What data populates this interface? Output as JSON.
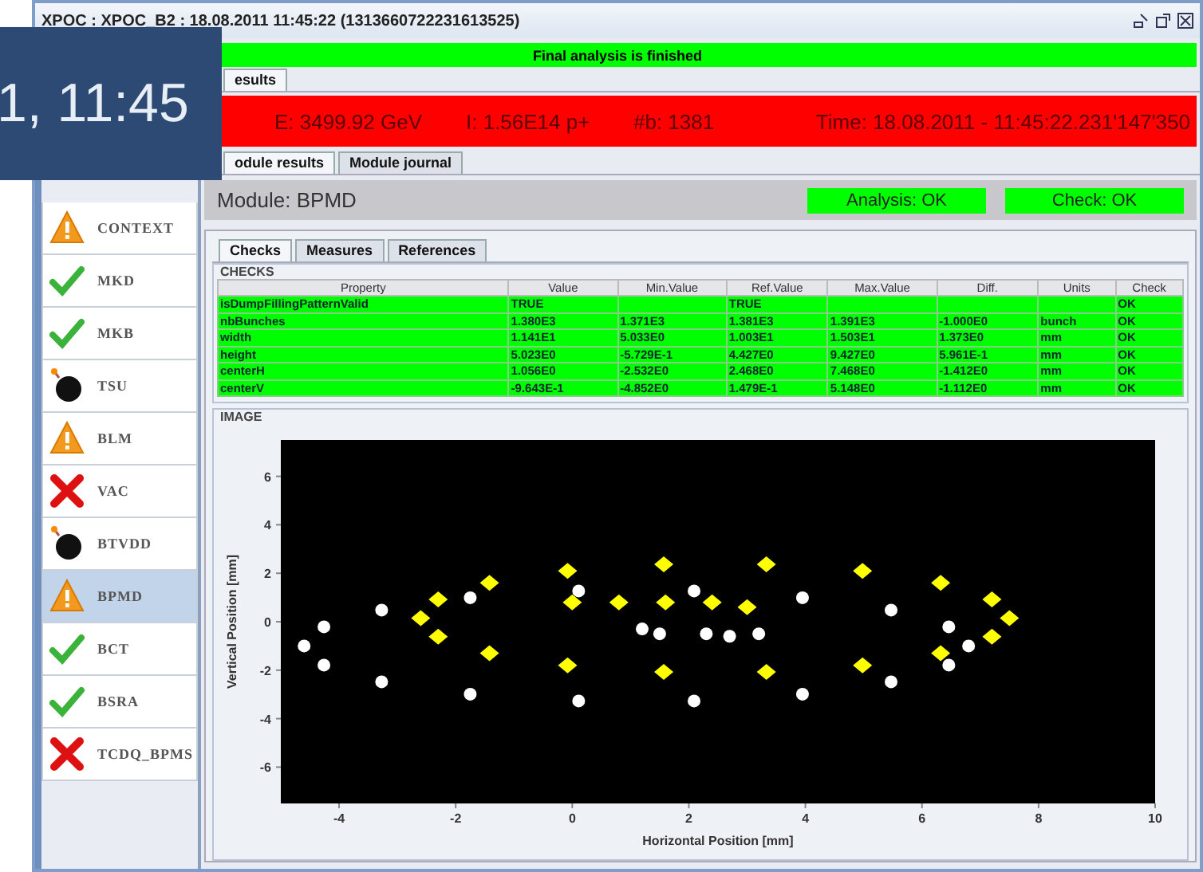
{
  "window": {
    "title": "XPOC : XPOC_B2 : 18.08.2011 11:45:22 (1313660722231613525)"
  },
  "overlay": {
    "clock": "1, 11:45"
  },
  "banner": {
    "text": "Final analysis is finished",
    "color": "#00ff00"
  },
  "top_tabs": [
    {
      "label": "esults",
      "selected": true
    }
  ],
  "beam_bar": {
    "color": "#ff0000",
    "energy": "E: 3499.92 GeV",
    "intensity": "I: 1.56E14 p+",
    "bunches": "#b: 1381",
    "time": "Time: 18.08.2011 - 11:45:22.231'147'350"
  },
  "module_tabs": [
    {
      "label": "odule results",
      "selected": true
    },
    {
      "label": "Module journal",
      "selected": false
    }
  ],
  "sidebar": {
    "items": [
      {
        "label": "CONTEXT",
        "kind": "warning",
        "selected": false
      },
      {
        "label": "MKD",
        "kind": "ok",
        "selected": false
      },
      {
        "label": "MKB",
        "kind": "ok",
        "selected": false
      },
      {
        "label": "TSU",
        "kind": "bomb",
        "selected": false
      },
      {
        "label": "BLM",
        "kind": "warning",
        "selected": false
      },
      {
        "label": "VAC",
        "kind": "error",
        "selected": false
      },
      {
        "label": "BTVDD",
        "kind": "bomb",
        "selected": false
      },
      {
        "label": "BPMD",
        "kind": "warning",
        "selected": true
      },
      {
        "label": "BCT",
        "kind": "ok",
        "selected": false
      },
      {
        "label": "BSRA",
        "kind": "ok",
        "selected": false
      },
      {
        "label": "TCDQ_BPMS",
        "kind": "error",
        "selected": false
      }
    ]
  },
  "module": {
    "title": "Module: BPMD",
    "badges": [
      {
        "text": "Analysis: OK",
        "color": "#00ff00"
      },
      {
        "text": "Check: OK",
        "color": "#00ff00"
      }
    ]
  },
  "detail_tabs": [
    {
      "label": "Checks",
      "selected": true
    },
    {
      "label": "Measures",
      "selected": false
    },
    {
      "label": "References",
      "selected": false
    }
  ],
  "checks": {
    "title": "CHECKS",
    "columns": [
      "Property",
      "Value",
      "Min.Value",
      "Ref.Value",
      "Max.Value",
      "Diff.",
      "Units",
      "Check"
    ],
    "rows": [
      {
        "color": "#00ff00",
        "cells": [
          "isDumpFillingPatternValid",
          "TRUE",
          "",
          "TRUE",
          "",
          "",
          "",
          "OK"
        ]
      },
      {
        "color": "#00ff00",
        "cells": [
          "nbBunches",
          "1.380E3",
          "1.371E3",
          "1.381E3",
          "1.391E3",
          "-1.000E0",
          "bunch",
          "OK"
        ]
      },
      {
        "color": "#00ff00",
        "cells": [
          "width",
          "1.141E1",
          "5.033E0",
          "1.003E1",
          "1.503E1",
          "1.373E0",
          "mm",
          "OK"
        ]
      },
      {
        "color": "#00ff00",
        "cells": [
          "height",
          "5.023E0",
          "-5.729E-1",
          "4.427E0",
          "9.427E0",
          "5.961E-1",
          "mm",
          "OK"
        ]
      },
      {
        "color": "#00ff00",
        "cells": [
          "centerH",
          "1.056E0",
          "-2.532E0",
          "2.468E0",
          "7.468E0",
          "-1.412E0",
          "mm",
          "OK"
        ]
      },
      {
        "color": "#00ff00",
        "cells": [
          "centerV",
          "-9.643E-1",
          "-4.852E0",
          "1.479E-1",
          "5.148E0",
          "-1.112E0",
          "mm",
          "OK"
        ]
      }
    ]
  },
  "image": {
    "title": "IMAGE",
    "chart_data": {
      "type": "scatter",
      "xlabel": "Horizontal Position [mm]",
      "ylabel": "Vertical Position [mm]",
      "xlim": [
        -5,
        10
      ],
      "ylim": [
        -7.5,
        7.5
      ],
      "xticks": [
        {
          "value": -4,
          "label": "-4"
        },
        {
          "value": -2,
          "label": "-2"
        },
        {
          "value": 0,
          "label": "0"
        },
        {
          "value": 2,
          "label": "2"
        },
        {
          "value": 4,
          "label": "4"
        },
        {
          "value": 6,
          "label": "6"
        },
        {
          "value": 8,
          "label": "8"
        },
        {
          "value": 10,
          "label": "10"
        }
      ],
      "yticks": [
        {
          "value": -6,
          "label": "-6"
        },
        {
          "value": -4,
          "label": "-4"
        },
        {
          "value": -2,
          "label": "-2"
        },
        {
          "value": 0,
          "label": "0"
        },
        {
          "value": 2,
          "label": "2"
        },
        {
          "value": 4,
          "label": "4"
        },
        {
          "value": 6,
          "label": "6"
        }
      ],
      "series": [
        {
          "color": "#ffffff",
          "x": [
            6.8,
            6.46,
            5.47,
            3.95,
            2.09,
            0.11,
            -1.75,
            -3.27,
            -4.26,
            -4.6,
            -4.26,
            -3.27,
            -1.75,
            0.11,
            2.09,
            3.95,
            5.47,
            6.46,
            1.2,
            1.5,
            2.3,
            2.7,
            3.2
          ],
          "values": [
            -1.0,
            -0.21,
            0.48,
            0.99,
            1.27,
            1.27,
            0.99,
            0.48,
            -0.21,
            -1.0,
            -1.79,
            -2.48,
            -2.99,
            -3.27,
            -3.27,
            -2.99,
            -2.48,
            -1.79,
            -0.3,
            -0.5,
            -0.5,
            -0.6,
            -0.5
          ]
        },
        {
          "color": "#ffff00",
          "x": [
            7.5,
            7.2,
            6.32,
            4.98,
            3.33,
            1.57,
            -0.08,
            -1.42,
            -2.3,
            -2.6,
            -2.3,
            -1.42,
            -0.08,
            1.57,
            3.33,
            4.98,
            6.32,
            7.2,
            0,
            0.8,
            1.6,
            2.4,
            3.0
          ],
          "values": [
            0.15,
            0.92,
            1.6,
            2.1,
            2.37,
            2.37,
            2.1,
            1.6,
            0.92,
            0.15,
            -0.62,
            -1.3,
            -1.8,
            -2.07,
            -2.07,
            -1.8,
            -1.3,
            -0.62,
            0.8,
            0.8,
            0.8,
            0.8,
            0.6
          ]
        }
      ]
    }
  }
}
